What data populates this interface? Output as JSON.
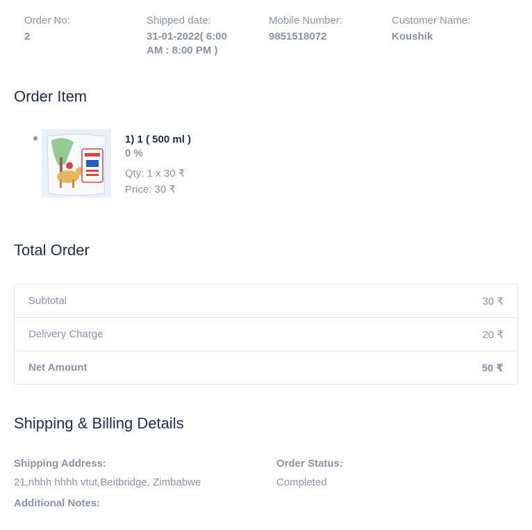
{
  "header": {
    "order_no_label": "Order No:",
    "order_no": "2",
    "shipped_label": "Shipped date:",
    "shipped_line1": "31-01-2022( 6:00",
    "shipped_line2": "AM : 8:00 PM )",
    "mobile_label": "Mobile Number:",
    "mobile": "9851518072",
    "customer_label": "Customer Name:",
    "customer": "Koushik"
  },
  "order_item": {
    "title": "Order Item",
    "items": [
      {
        "name": "1) 1 ( 500 ml )",
        "discount": "0 %",
        "qty": "Qty: 1 x 30 ₹",
        "price": "Price: 30 ₹",
        "image_icon": "milk-pouch-image"
      }
    ]
  },
  "total_order": {
    "title": "Total Order",
    "rows": [
      {
        "label": "Subtotal",
        "value": "30 ₹"
      },
      {
        "label": "Delivery Charge",
        "value": "20 ₹"
      },
      {
        "label": "Net Amount",
        "value": "50 ₹"
      }
    ]
  },
  "shipping": {
    "title": "Shipping & Billing Details",
    "address_label": "Shipping Address:",
    "address": "21,nhhh hhhh vtut,Beitbridge, Zimbabwe",
    "status_label": "Order Status:",
    "status": "Completed",
    "notes_label": "Additional Notes:"
  },
  "colors": {
    "heading": "#1f2d4a",
    "muted": "#8a93a6",
    "border": "#dfe3ea"
  }
}
